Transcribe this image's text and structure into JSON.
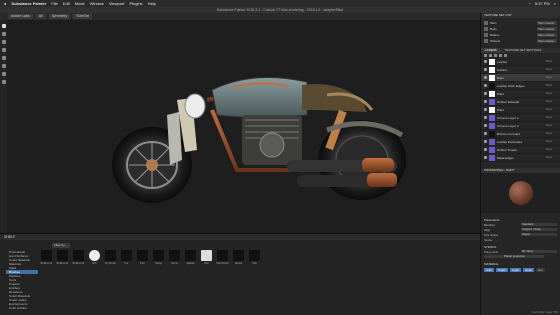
{
  "menubar": {
    "app": "Substance Painter",
    "items": [
      "File",
      "Edit",
      "Mode",
      "Window",
      "Viewport",
      "Plugins",
      "Help"
    ],
    "clock": "5:37 PM"
  },
  "window_title": "Substance Painter 2018.3.1 - Custom-77 bike-rendering - 2018.1.0 - adapter/Bike",
  "toolbar": {
    "buttons": [
      "Adobe Labs",
      "All",
      "Symmetry",
      "Size/Sel"
    ]
  },
  "shelf": {
    "title": "SHELF",
    "search_placeholder": "Filter by...",
    "categories": [
      "Procedurals",
      "Hard Surfaces",
      "Smart Materials",
      "Materials",
      "Mask",
      "Brushes",
      "Particles",
      "Tools",
      "Projects",
      "Emitters",
      "Receivers",
      "Smart Materials",
      "Smart masks",
      "Environments",
      "Color profiles"
    ],
    "selected_category": "Brushes",
    "items": [
      "Bristles 01",
      "Bristles 02",
      "Bristles 03",
      "Dirt",
      "Dry Brush",
      "Fur",
      "Pen",
      "Spray",
      "Stone",
      "Splatter",
      "Wet",
      "Hard Brush",
      "Round",
      "Soft"
    ]
  },
  "right_panel": {
    "texture_set_header": "TEXTURE SET LIST",
    "texture_sets": [
      {
        "name": "Main",
        "shader": "Main shader"
      },
      {
        "name": "Body",
        "shader": "Main shader"
      },
      {
        "name": "Brakes",
        "shader": "Main shader"
      },
      {
        "name": "Wheels",
        "shader": "Main shader"
      },
      {
        "name": "Engine",
        "shader": "Main shader"
      }
    ],
    "tabs": [
      "LAYERS",
      "TEXTURE SET SETTINGS"
    ],
    "layers": [
      {
        "name": "Leather",
        "blend": "Norm",
        "thumb": "white"
      },
      {
        "name": "Surface",
        "blend": "Norm",
        "thumb": "white"
      },
      {
        "name": "Base",
        "blend": "Norm",
        "thumb": "white"
      },
      {
        "name": "Leather Worn Edges",
        "blend": "Norm",
        "thumb": "dark"
      },
      {
        "name": "Paint",
        "blend": "Norm",
        "thumb": "white"
      },
      {
        "name": "Rubber Sidewall",
        "blend": "Norm",
        "thumb": "purple"
      },
      {
        "name": "Paint",
        "blend": "Norm",
        "thumb": "white"
      },
      {
        "name": "Chrome Layer 1",
        "blend": "Norm",
        "thumb": "purple"
      },
      {
        "name": "Chrome Layer 2",
        "blend": "Norm",
        "thumb": "purple"
      },
      {
        "name": "Bronze Corroded",
        "blend": "Norm",
        "thumb": "dark"
      },
      {
        "name": "Leather Perforated",
        "blend": "Norm",
        "thumb": "purple"
      },
      {
        "name": "Rubber Treads",
        "blend": "Norm",
        "thumb": "purple"
      },
      {
        "name": "Metal Edges",
        "blend": "Norm",
        "thumb": "purple"
      }
    ],
    "props_header": "PROPERTIES - PAINT",
    "props": {
      "parameters": "Parameters",
      "blending_label": "Blending",
      "blending_value": "Standard",
      "align_label": "Align",
      "align_value": "Tangent | Wrap",
      "size_label": "Size Space",
      "size_value": "Object",
      "stroke_label": "Stroke",
      "stencil_label": "STENCIL",
      "tiling_label": "Tiling mode",
      "tiling_value": "No Tiling",
      "projection": "Planar projection",
      "material_label": "MATERIAL",
      "material_buttons": [
        "color",
        "height",
        "rough",
        "metal",
        "nrm"
      ]
    },
    "status": "Cache Disk Usage 75%"
  },
  "colors": {
    "accent": "#3f6ea8",
    "bike_paint": "#6c7f84",
    "copper": "#a55a36"
  }
}
